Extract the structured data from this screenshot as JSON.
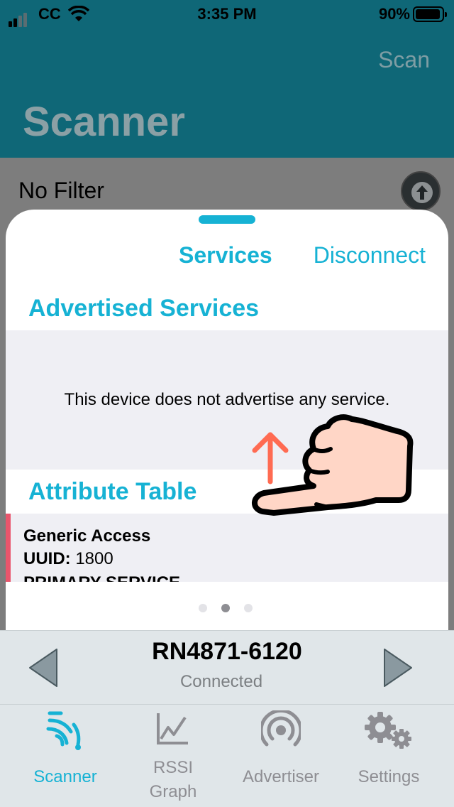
{
  "status_bar": {
    "carrier": "CC",
    "time": "3:35 PM",
    "battery_percent": "90%"
  },
  "nav": {
    "title": "Scanner",
    "scan_label": "Scan"
  },
  "filter": {
    "label": "No Filter"
  },
  "sheet": {
    "services_label": "Services",
    "disconnect_label": "Disconnect",
    "advertised_title": "Advertised Services",
    "no_service_text": "This device does not advertise any service.",
    "attribute_title": "Attribute Table",
    "attribute": {
      "name": "Generic Access",
      "uuid_label": "UUID:",
      "uuid_value": "1800",
      "type": "PRIMARY SERVICE"
    },
    "page_count": 3,
    "active_page": 2
  },
  "device": {
    "name": "RN4871-6120",
    "status": "Connected"
  },
  "tabs": [
    {
      "label": "Scanner",
      "icon": "scanner-icon",
      "active": true
    },
    {
      "label": "RSSI\nGraph",
      "icon": "rssi-graph-icon",
      "active": false
    },
    {
      "label": "Advertiser",
      "icon": "advertiser-icon",
      "active": false
    },
    {
      "label": "Settings",
      "icon": "settings-gear-icon",
      "active": false
    }
  ],
  "colors": {
    "header": "#0f6777",
    "accent": "#16b2d4",
    "attribute_marker": "#e9556c",
    "hint_arrow": "#ff6b52"
  }
}
